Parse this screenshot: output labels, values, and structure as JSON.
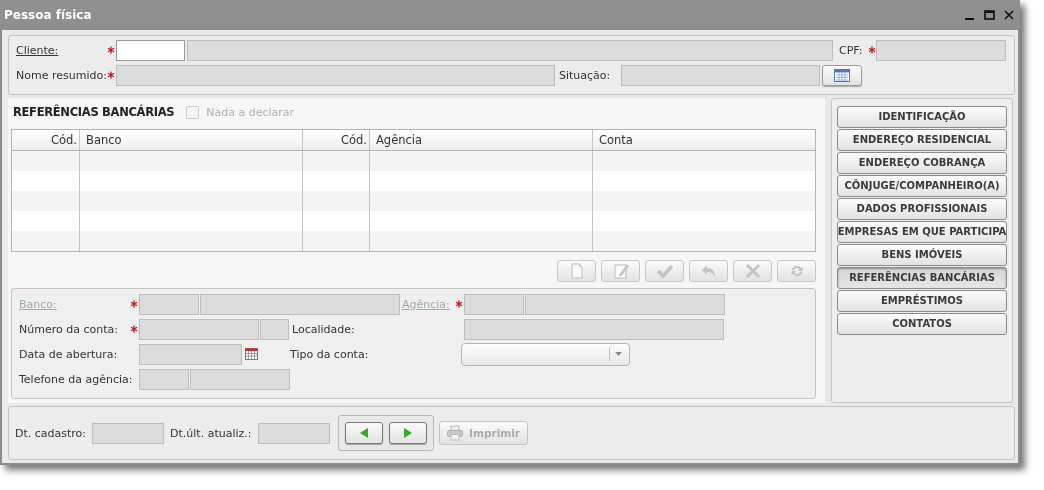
{
  "window": {
    "title": "Pessoa física"
  },
  "header": {
    "cliente": {
      "label": "Cliente:",
      "link": true,
      "disabled": false,
      "required": true,
      "fields": [
        {
          "disabled": false
        },
        {
          "disabled": true
        }
      ]
    },
    "cpf": {
      "label": "CPF:",
      "required": true,
      "fields": [
        {
          "disabled": true
        }
      ]
    },
    "nome_resumido": {
      "label": "Nome resumido:",
      "required": true,
      "fields": [
        {
          "disabled": true
        }
      ]
    },
    "situacao": {
      "label": "Situação:",
      "fields": [
        {
          "disabled": true
        }
      ]
    }
  },
  "section": {
    "title": "REFERÊNCIAS BANCÁRIAS",
    "checkbox": {
      "label": "Nada a declarar",
      "checked": false,
      "disabled": true
    }
  },
  "table": {
    "columns": [
      {
        "label": "Cód.",
        "kind": "code"
      },
      {
        "label": "Banco",
        "kind": "text"
      },
      {
        "label": "Cód.",
        "kind": "code"
      },
      {
        "label": "Agência",
        "kind": "text"
      },
      {
        "label": "Conta",
        "kind": "text"
      }
    ]
  },
  "toolbar": [
    {
      "kind": "new",
      "disabled": true
    },
    {
      "kind": "edit",
      "disabled": true
    },
    {
      "kind": "confirm",
      "disabled": true
    },
    {
      "kind": "undo",
      "disabled": true
    },
    {
      "kind": "delete",
      "disabled": true
    },
    {
      "kind": "refresh",
      "disabled": true
    }
  ],
  "form": {
    "banco": {
      "label": "Banco:",
      "link": true,
      "disabled": true,
      "required": true,
      "fields": [
        {
          "disabled": true
        },
        {
          "disabled": true
        }
      ]
    },
    "agencia": {
      "label": "Agência:",
      "link": true,
      "disabled": true,
      "required": true,
      "fields": [
        {
          "disabled": true
        },
        {
          "disabled": true
        }
      ]
    },
    "numero_conta": {
      "label": "Número da conta:",
      "required": true,
      "fields": [
        {
          "disabled": true
        },
        {
          "disabled": true
        }
      ]
    },
    "localidade": {
      "label": "Localidade:",
      "fields": [
        {
          "disabled": true
        }
      ]
    },
    "data_abertura": {
      "label": "Data de abertura:",
      "fields": [
        {
          "disabled": true
        }
      ]
    },
    "tipo_conta": {
      "label": "Tipo da conta:"
    },
    "telefone_agencia": {
      "label": "Telefone da agência:",
      "fields": [
        {
          "disabled": true
        },
        {
          "disabled": true
        }
      ]
    }
  },
  "nav": [
    {
      "label": "IDENTIFICAÇÃO",
      "selected": false
    },
    {
      "label": "ENDEREÇO RESIDENCIAL",
      "selected": false
    },
    {
      "label": "ENDEREÇO COBRANÇA",
      "selected": false
    },
    {
      "label": "CÔNJUGE/COMPANHEIRO(A)",
      "selected": false
    },
    {
      "label": "DADOS PROFISSIONAIS",
      "selected": false
    },
    {
      "label": "EMPRESAS EM QUE PARTICIPA",
      "selected": false
    },
    {
      "label": "BENS IMÓVEIS",
      "selected": false
    },
    {
      "label": "REFERÊNCIAS BANCÁRIAS",
      "selected": true
    },
    {
      "label": "EMPRÉSTIMOS",
      "selected": false
    },
    {
      "label": "CONTATOS",
      "selected": false
    }
  ],
  "footer": {
    "dt_cadastro": {
      "label": "Dt. cadastro:",
      "fields": [
        {
          "disabled": true
        }
      ]
    },
    "dt_atualizacao": {
      "label": "Dt.últ. atualiz.:",
      "fields": [
        {
          "disabled": true
        }
      ]
    },
    "print_button": {
      "label": "Imprimir",
      "disabled": true
    }
  }
}
